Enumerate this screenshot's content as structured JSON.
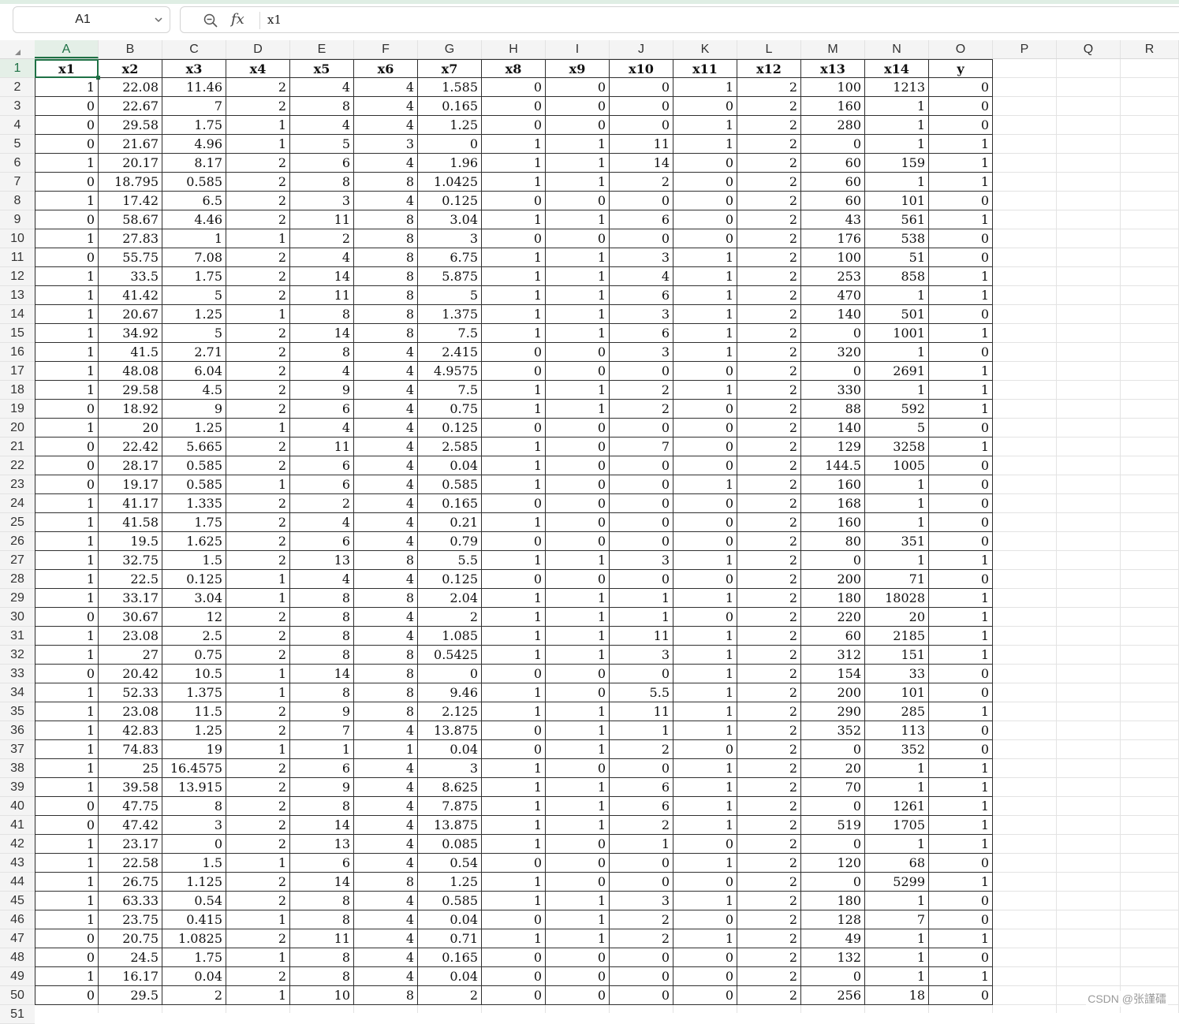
{
  "formula_bar": {
    "cell_ref": "A1",
    "fx_label": "fx",
    "content": "x1"
  },
  "columns": [
    "A",
    "B",
    "C",
    "D",
    "E",
    "F",
    "G",
    "H",
    "I",
    "J",
    "K",
    "L",
    "M",
    "N",
    "O",
    "P",
    "Q",
    "R"
  ],
  "active_column": "A",
  "active_row": "1",
  "sheet": {
    "headers": [
      "x1",
      "x2",
      "x3",
      "x4",
      "x5",
      "x6",
      "x7",
      "x8",
      "x9",
      "x10",
      "x11",
      "x12",
      "x13",
      "x14",
      "y"
    ],
    "rows": [
      [
        "1",
        "22.08",
        "11.46",
        "2",
        "4",
        "4",
        "1.585",
        "0",
        "0",
        "0",
        "1",
        "2",
        "100",
        "1213",
        "0"
      ],
      [
        "0",
        "22.67",
        "7",
        "2",
        "8",
        "4",
        "0.165",
        "0",
        "0",
        "0",
        "0",
        "2",
        "160",
        "1",
        "0"
      ],
      [
        "0",
        "29.58",
        "1.75",
        "1",
        "4",
        "4",
        "1.25",
        "0",
        "0",
        "0",
        "1",
        "2",
        "280",
        "1",
        "0"
      ],
      [
        "0",
        "21.67",
        "4.96",
        "1",
        "5",
        "3",
        "0",
        "1",
        "1",
        "11",
        "1",
        "2",
        "0",
        "1",
        "1"
      ],
      [
        "1",
        "20.17",
        "8.17",
        "2",
        "6",
        "4",
        "1.96",
        "1",
        "1",
        "14",
        "0",
        "2",
        "60",
        "159",
        "1"
      ],
      [
        "0",
        "18.795",
        "0.585",
        "2",
        "8",
        "8",
        "1.0425",
        "1",
        "1",
        "2",
        "0",
        "2",
        "60",
        "1",
        "1"
      ],
      [
        "1",
        "17.42",
        "6.5",
        "2",
        "3",
        "4",
        "0.125",
        "0",
        "0",
        "0",
        "0",
        "2",
        "60",
        "101",
        "0"
      ],
      [
        "0",
        "58.67",
        "4.46",
        "2",
        "11",
        "8",
        "3.04",
        "1",
        "1",
        "6",
        "0",
        "2",
        "43",
        "561",
        "1"
      ],
      [
        "1",
        "27.83",
        "1",
        "1",
        "2",
        "8",
        "3",
        "0",
        "0",
        "0",
        "0",
        "2",
        "176",
        "538",
        "0"
      ],
      [
        "0",
        "55.75",
        "7.08",
        "2",
        "4",
        "8",
        "6.75",
        "1",
        "1",
        "3",
        "1",
        "2",
        "100",
        "51",
        "0"
      ],
      [
        "1",
        "33.5",
        "1.75",
        "2",
        "14",
        "8",
        "5.875",
        "1",
        "1",
        "4",
        "1",
        "2",
        "253",
        "858",
        "1"
      ],
      [
        "1",
        "41.42",
        "5",
        "2",
        "11",
        "8",
        "5",
        "1",
        "1",
        "6",
        "1",
        "2",
        "470",
        "1",
        "1"
      ],
      [
        "1",
        "20.67",
        "1.25",
        "1",
        "8",
        "8",
        "1.375",
        "1",
        "1",
        "3",
        "1",
        "2",
        "140",
        "501",
        "0"
      ],
      [
        "1",
        "34.92",
        "5",
        "2",
        "14",
        "8",
        "7.5",
        "1",
        "1",
        "6",
        "1",
        "2",
        "0",
        "1001",
        "1"
      ],
      [
        "1",
        "41.5",
        "2.71",
        "2",
        "8",
        "4",
        "2.415",
        "0",
        "0",
        "3",
        "1",
        "2",
        "320",
        "1",
        "0"
      ],
      [
        "1",
        "48.08",
        "6.04",
        "2",
        "4",
        "4",
        "4.9575",
        "0",
        "0",
        "0",
        "0",
        "2",
        "0",
        "2691",
        "1"
      ],
      [
        "1",
        "29.58",
        "4.5",
        "2",
        "9",
        "4",
        "7.5",
        "1",
        "1",
        "2",
        "1",
        "2",
        "330",
        "1",
        "1"
      ],
      [
        "0",
        "18.92",
        "9",
        "2",
        "6",
        "4",
        "0.75",
        "1",
        "1",
        "2",
        "0",
        "2",
        "88",
        "592",
        "1"
      ],
      [
        "1",
        "20",
        "1.25",
        "1",
        "4",
        "4",
        "0.125",
        "0",
        "0",
        "0",
        "0",
        "2",
        "140",
        "5",
        "0"
      ],
      [
        "0",
        "22.42",
        "5.665",
        "2",
        "11",
        "4",
        "2.585",
        "1",
        "0",
        "7",
        "0",
        "2",
        "129",
        "3258",
        "1"
      ],
      [
        "0",
        "28.17",
        "0.585",
        "2",
        "6",
        "4",
        "0.04",
        "1",
        "0",
        "0",
        "0",
        "2",
        "144.5",
        "1005",
        "0"
      ],
      [
        "0",
        "19.17",
        "0.585",
        "1",
        "6",
        "4",
        "0.585",
        "1",
        "0",
        "0",
        "1",
        "2",
        "160",
        "1",
        "0"
      ],
      [
        "1",
        "41.17",
        "1.335",
        "2",
        "2",
        "4",
        "0.165",
        "0",
        "0",
        "0",
        "0",
        "2",
        "168",
        "1",
        "0"
      ],
      [
        "1",
        "41.58",
        "1.75",
        "2",
        "4",
        "4",
        "0.21",
        "1",
        "0",
        "0",
        "0",
        "2",
        "160",
        "1",
        "0"
      ],
      [
        "1",
        "19.5",
        "1.625",
        "2",
        "6",
        "4",
        "0.79",
        "0",
        "0",
        "0",
        "0",
        "2",
        "80",
        "351",
        "0"
      ],
      [
        "1",
        "32.75",
        "1.5",
        "2",
        "13",
        "8",
        "5.5",
        "1",
        "1",
        "3",
        "1",
        "2",
        "0",
        "1",
        "1"
      ],
      [
        "1",
        "22.5",
        "0.125",
        "1",
        "4",
        "4",
        "0.125",
        "0",
        "0",
        "0",
        "0",
        "2",
        "200",
        "71",
        "0"
      ],
      [
        "1",
        "33.17",
        "3.04",
        "1",
        "8",
        "8",
        "2.04",
        "1",
        "1",
        "1",
        "1",
        "2",
        "180",
        "18028",
        "1"
      ],
      [
        "0",
        "30.67",
        "12",
        "2",
        "8",
        "4",
        "2",
        "1",
        "1",
        "1",
        "0",
        "2",
        "220",
        "20",
        "1"
      ],
      [
        "1",
        "23.08",
        "2.5",
        "2",
        "8",
        "4",
        "1.085",
        "1",
        "1",
        "11",
        "1",
        "2",
        "60",
        "2185",
        "1"
      ],
      [
        "1",
        "27",
        "0.75",
        "2",
        "8",
        "8",
        "0.5425",
        "1",
        "1",
        "3",
        "1",
        "2",
        "312",
        "151",
        "1"
      ],
      [
        "0",
        "20.42",
        "10.5",
        "1",
        "14",
        "8",
        "0",
        "0",
        "0",
        "0",
        "1",
        "2",
        "154",
        "33",
        "0"
      ],
      [
        "1",
        "52.33",
        "1.375",
        "1",
        "8",
        "8",
        "9.46",
        "1",
        "0",
        "5.5",
        "1",
        "2",
        "200",
        "101",
        "0"
      ],
      [
        "1",
        "23.08",
        "11.5",
        "2",
        "9",
        "8",
        "2.125",
        "1",
        "1",
        "11",
        "1",
        "2",
        "290",
        "285",
        "1"
      ],
      [
        "1",
        "42.83",
        "1.25",
        "2",
        "7",
        "4",
        "13.875",
        "0",
        "1",
        "1",
        "1",
        "2",
        "352",
        "113",
        "0"
      ],
      [
        "1",
        "74.83",
        "19",
        "1",
        "1",
        "1",
        "0.04",
        "0",
        "1",
        "2",
        "0",
        "2",
        "0",
        "352",
        "0"
      ],
      [
        "1",
        "25",
        "16.4575",
        "2",
        "6",
        "4",
        "3",
        "1",
        "0",
        "0",
        "1",
        "2",
        "20",
        "1",
        "1"
      ],
      [
        "1",
        "39.58",
        "13.915",
        "2",
        "9",
        "4",
        "8.625",
        "1",
        "1",
        "6",
        "1",
        "2",
        "70",
        "1",
        "1"
      ],
      [
        "0",
        "47.75",
        "8",
        "2",
        "8",
        "4",
        "7.875",
        "1",
        "1",
        "6",
        "1",
        "2",
        "0",
        "1261",
        "1"
      ],
      [
        "0",
        "47.42",
        "3",
        "2",
        "14",
        "4",
        "13.875",
        "1",
        "1",
        "2",
        "1",
        "2",
        "519",
        "1705",
        "1"
      ],
      [
        "1",
        "23.17",
        "0",
        "2",
        "13",
        "4",
        "0.085",
        "1",
        "0",
        "1",
        "0",
        "2",
        "0",
        "1",
        "1"
      ],
      [
        "1",
        "22.58",
        "1.5",
        "1",
        "6",
        "4",
        "0.54",
        "0",
        "0",
        "0",
        "1",
        "2",
        "120",
        "68",
        "0"
      ],
      [
        "1",
        "26.75",
        "1.125",
        "2",
        "14",
        "8",
        "1.25",
        "1",
        "0",
        "0",
        "0",
        "2",
        "0",
        "5299",
        "1"
      ],
      [
        "1",
        "63.33",
        "0.54",
        "2",
        "8",
        "4",
        "0.585",
        "1",
        "1",
        "3",
        "1",
        "2",
        "180",
        "1",
        "0"
      ],
      [
        "1",
        "23.75",
        "0.415",
        "1",
        "8",
        "4",
        "0.04",
        "0",
        "1",
        "2",
        "0",
        "2",
        "128",
        "7",
        "0"
      ],
      [
        "0",
        "20.75",
        "1.0825",
        "2",
        "11",
        "4",
        "0.71",
        "1",
        "1",
        "2",
        "1",
        "2",
        "49",
        "1",
        "1"
      ],
      [
        "0",
        "24.5",
        "1.75",
        "1",
        "8",
        "4",
        "0.165",
        "0",
        "0",
        "0",
        "0",
        "2",
        "132",
        "1",
        "0"
      ],
      [
        "1",
        "16.17",
        "0.04",
        "2",
        "8",
        "4",
        "0.04",
        "0",
        "0",
        "0",
        "0",
        "2",
        "0",
        "1",
        "1"
      ],
      [
        "0",
        "29.5",
        "2",
        "1",
        "10",
        "8",
        "2",
        "0",
        "0",
        "0",
        "0",
        "2",
        "256",
        "18",
        "0"
      ]
    ]
  },
  "watermark": "CSDN @张謹礌"
}
